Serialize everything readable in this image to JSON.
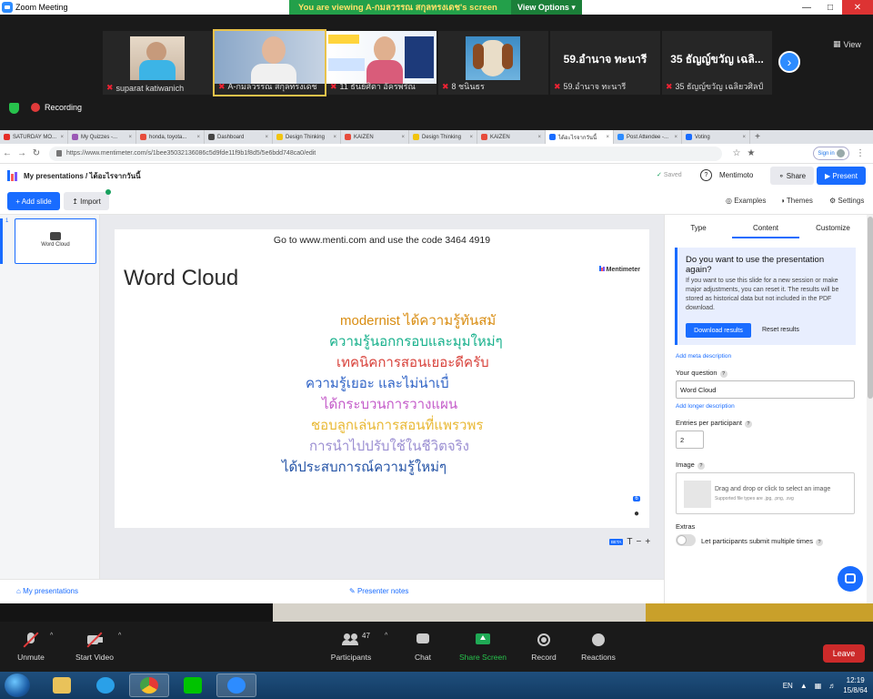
{
  "zoom": {
    "window_title": "Zoom Meeting",
    "viewing_banner": "You are viewing A-กมลวรรณ สกุลทรงเดช's screen",
    "view_options": "View Options",
    "view_label": "View",
    "recording_label": "Recording",
    "participants_strip": [
      {
        "name": "suparat katiwanich"
      },
      {
        "name": "A-กมลวรรณ สกุลทรงเดช"
      },
      {
        "name": "11 ธันย์ศิตา อัครพริณ"
      },
      {
        "name": "8 ชนินธร"
      },
      {
        "name": "59.อำนาจ ทะนารี",
        "big_name": "59.อำนาจ ทะนารี"
      },
      {
        "name": "35 ธัญญ์ขวัญ เฉลิยวศิลป์",
        "big_name": "35 ธัญญ์ขวัญ เฉลิ..."
      }
    ],
    "controls": {
      "unmute": "Unmute",
      "start_video": "Start Video",
      "participants": "Participants",
      "participant_count": "47",
      "chat": "Chat",
      "share_screen": "Share Screen",
      "record": "Record",
      "reactions": "Reactions",
      "leave": "Leave"
    }
  },
  "browser": {
    "tabs": [
      {
        "label": "SATURDAY MO...",
        "color": "#e52d27"
      },
      {
        "label": "My Quizzes -...",
        "color": "#9b59b6"
      },
      {
        "label": "honda, toyota...",
        "color": "#e74c3c"
      },
      {
        "label": "Dashboard",
        "color": "#444444"
      },
      {
        "label": "Design Thinking",
        "color": "#f1c40f"
      },
      {
        "label": "KAIZEN",
        "color": "#e74c3c"
      },
      {
        "label": "Design Thinking",
        "color": "#f1c40f"
      },
      {
        "label": "KAIZEN",
        "color": "#e74c3c"
      },
      {
        "label": "ได้อะไรจากวันนี้",
        "color": "#196cff",
        "active": true
      },
      {
        "label": "Post Attendee -...",
        "color": "#2d8cff"
      },
      {
        "label": "Voting",
        "color": "#196cff"
      }
    ],
    "url": "https://www.mentimeter.com/s/1bee35032136086c5d9fde11f9b1f8d5/5e6bdd748ca0/edit",
    "signin": "Sign in"
  },
  "menti": {
    "breadcrumb": "My presentations / ได้อะไรจากวันนี้",
    "saved": "Saved",
    "help": "?",
    "mentimoto": "Mentimoto",
    "share": "Share",
    "present": "Present",
    "add_slide": "+ Add slide",
    "import": "Import",
    "examples": "Examples",
    "themes": "Themes",
    "settings": "Settings",
    "slide_number": "1",
    "thumb_label": "Word Cloud",
    "join_line": "Go to www.menti.com and use the code 3464 4919",
    "slide_title": "Word Cloud",
    "brand": "Mentimeter",
    "response_count": "6",
    "words": [
      {
        "text": "modernist ได้ความรู้ทันสมั",
        "color": "#d98d12"
      },
      {
        "text": "ความรู้นอกกรอบและมุมใหม่ๆ",
        "color": "#16b08b"
      },
      {
        "text": "เทคนิคการสอนเยอะดีครับ",
        "color": "#d8413a"
      },
      {
        "text": "ความรู้เยอะ และไม่น่าเบื่",
        "color": "#2f63c6"
      },
      {
        "text": "ได้กระบวนการวางแผน",
        "color": "#c45bc9"
      },
      {
        "text": "ชอบลูกเล่นการสอนที่แพรวพร",
        "color": "#e9b833"
      },
      {
        "text": "การนำไปปรับใช้ในชีวิตจริง",
        "color": "#9b8fd2"
      },
      {
        "text": "ได้ประสบการณ์ความรู้ใหม่ๆ",
        "color": "#2453a6"
      }
    ],
    "canvas_tools": {
      "beta": "BETA",
      "t": "T",
      "minus": "−",
      "plus": "+"
    },
    "my_presentations": "My presentations",
    "presenter_notes": "Presenter notes",
    "panel": {
      "tabs": [
        "Type",
        "Content",
        "Customize"
      ],
      "info_heading": "Do you want to use the presentation again?",
      "info_body": "If you want to use this slide for a new session or make major adjustments, you can reset it. The results will be stored as historical data but not included in the PDF download.",
      "download_results": "Download results",
      "reset_results": "Reset results",
      "add_meta": "Add meta description",
      "your_question": "Your question",
      "question_value": "Word Cloud",
      "add_longer": "Add longer description",
      "entries_label": "Entries per participant",
      "entries_value": "2",
      "image_label": "Image",
      "image_drop": "Drag and drop or click to select an image",
      "image_types": "Supported file types are .jpg, .png, .svg",
      "extras_label": "Extras",
      "multiple_label": "Let participants submit multiple times"
    }
  },
  "taskbar": {
    "lang": "EN",
    "time": "12:19",
    "date": "15/8/64"
  }
}
